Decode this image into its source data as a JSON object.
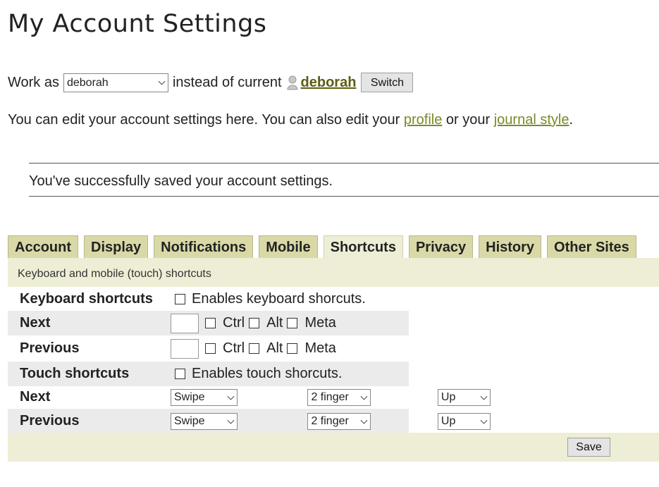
{
  "page": {
    "title": "My Account Settings"
  },
  "workas": {
    "label": "Work as",
    "selected": "deborah",
    "middle": "instead of current",
    "current_user": "deborah",
    "switch_label": "Switch"
  },
  "intro": {
    "text1": "You can edit your account settings here. You can also edit your",
    "profile_link": "profile",
    "or": "or your",
    "journal_link": "journal style",
    "end": "."
  },
  "notice": "You've successfully saved your account settings.",
  "tabs": [
    "Account",
    "Display",
    "Notifications",
    "Mobile",
    "Shortcuts",
    "Privacy",
    "History",
    "Other Sites"
  ],
  "active_tab": "Shortcuts",
  "panel": {
    "heading": "Keyboard and mobile (touch) shortcuts",
    "keyboard": {
      "label": "Keyboard shortcuts",
      "enable_text": "Enables keyboard shorcuts."
    },
    "kb_next": {
      "label": "Next"
    },
    "kb_prev": {
      "label": "Previous"
    },
    "modifiers": {
      "ctrl": "Ctrl",
      "alt": "Alt",
      "meta": "Meta"
    },
    "touch": {
      "label": "Touch shortcuts",
      "enable_text": "Enables touch shorcuts."
    },
    "touch_next": {
      "label": "Next",
      "gesture": "Swipe",
      "fingers": "2 finger",
      "direction": "Up"
    },
    "touch_prev": {
      "label": "Previous",
      "gesture": "Swipe",
      "fingers": "2 finger",
      "direction": "Up"
    }
  },
  "footer": {
    "save_label": "Save"
  },
  "colors": {
    "tab_bg": "#d9d9a8",
    "panel_bg": "#eeeed6",
    "link": "#7a8a2a",
    "user_link": "#5c5e12"
  },
  "icons": {
    "user": "user-icon",
    "dropdown": "chevron-down-icon"
  }
}
